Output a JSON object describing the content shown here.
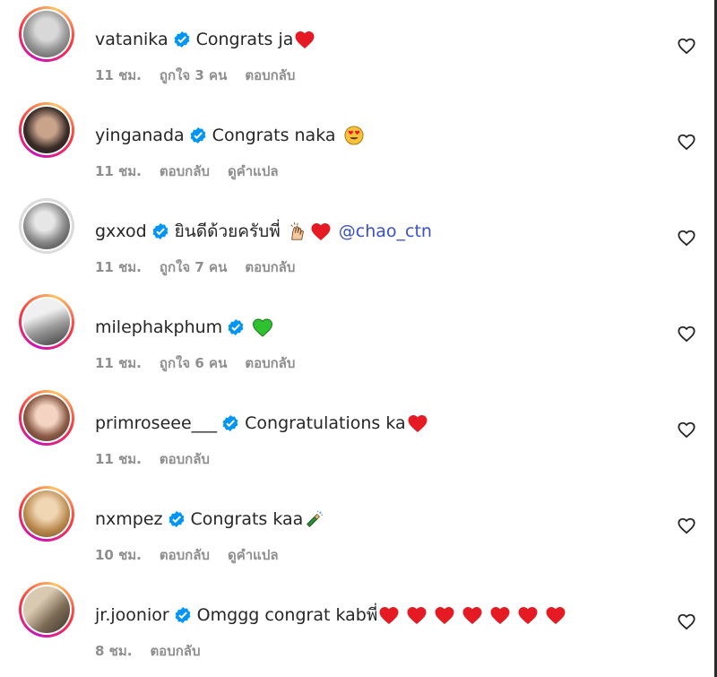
{
  "ui": {
    "accent": "#0095f6",
    "meta_color": "#8e8e8e",
    "mention_color": "#3a50c8"
  },
  "comments": [
    {
      "username": "vatanika",
      "text": "Congrats ja",
      "emojis": [
        "red-heart"
      ],
      "mention": "",
      "time": "11 ชม.",
      "likes": "ถูกใจ 3 คน",
      "reply": "ตอบกลับ",
      "translate": ""
    },
    {
      "username": "yinganada",
      "text": "Congrats naka",
      "emojis": [
        "heart-eyes"
      ],
      "mention": "",
      "time": "11 ชม.",
      "likes": "",
      "reply": "ตอบกลับ",
      "translate": "ดูคำแปล"
    },
    {
      "username": "gxxod",
      "text": "ยินดีด้วยครับพี่",
      "emojis": [
        "raised-hands",
        "red-heart"
      ],
      "mention": "@chao_ctn",
      "time": "11 ชม.",
      "likes": "ถูกใจ 7 คน",
      "reply": "ตอบกลับ",
      "translate": ""
    },
    {
      "username": "milephakphum",
      "text": "",
      "emojis": [
        "green-heart"
      ],
      "mention": "",
      "time": "11 ชม.",
      "likes": "ถูกใจ 6 คน",
      "reply": "ตอบกลับ",
      "translate": ""
    },
    {
      "username": "primroseee___",
      "text": "Congratulations ka",
      "emojis": [
        "red-heart"
      ],
      "mention": "",
      "time": "11 ชม.",
      "likes": "",
      "reply": "ตอบกลับ",
      "translate": ""
    },
    {
      "username": "nxmpez",
      "text": "Congrats kaa",
      "emojis": [
        "champagne"
      ],
      "mention": "",
      "time": "10 ชม.",
      "likes": "",
      "reply": "ตอบกลับ",
      "translate": "ดูคำแปล"
    },
    {
      "username": "jr.joonior",
      "text": "Omggg congrat kabพี่",
      "emojis": [
        "red-heart",
        "red-heart",
        "red-heart",
        "red-heart",
        "red-heart",
        "red-heart",
        "red-heart"
      ],
      "mention": "",
      "time": "8 ชม.",
      "likes": "",
      "reply": "ตอบกลับ",
      "translate": ""
    }
  ]
}
